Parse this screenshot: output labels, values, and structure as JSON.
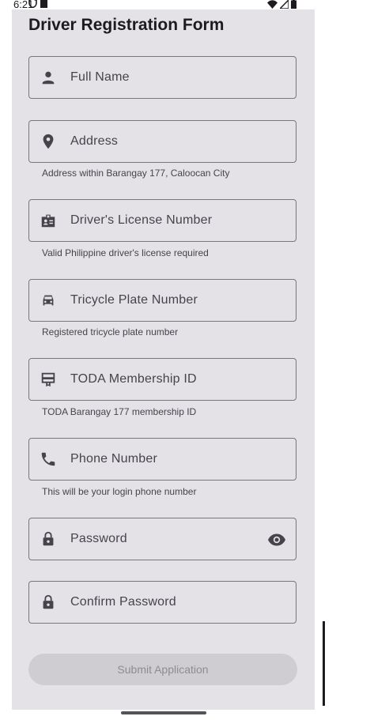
{
  "status_bar": {
    "time": "6:21"
  },
  "form": {
    "title": "Driver Registration Form",
    "fields": [
      {
        "label": "Full Name",
        "icon": "person-icon"
      },
      {
        "label": "Address",
        "icon": "location-pin-icon",
        "helper": "Address within Barangay 177, Caloocan City"
      },
      {
        "label": "Driver's License Number",
        "icon": "badge-icon",
        "helper": "Valid Philippine driver's license required"
      },
      {
        "label": "Tricycle Plate Number",
        "icon": "car-icon",
        "helper": "Registered tricycle plate number"
      },
      {
        "label": "TODA Membership ID",
        "icon": "card-membership-icon",
        "helper": "TODA Barangay 177 membership ID"
      },
      {
        "label": "Phone Number",
        "icon": "phone-icon",
        "helper": "This will be your login phone number"
      },
      {
        "label": "Password",
        "icon": "lock-icon",
        "trailing_icon": "eye-icon"
      },
      {
        "label": "Confirm Password",
        "icon": "lock-icon"
      }
    ],
    "submit_label": "Submit Application"
  },
  "colors": {
    "card_background": "#e4e2e7",
    "outline": "#79767d",
    "submit_disabled_bg": "#cfcdd2",
    "submit_disabled_text": "#8e8c91"
  }
}
